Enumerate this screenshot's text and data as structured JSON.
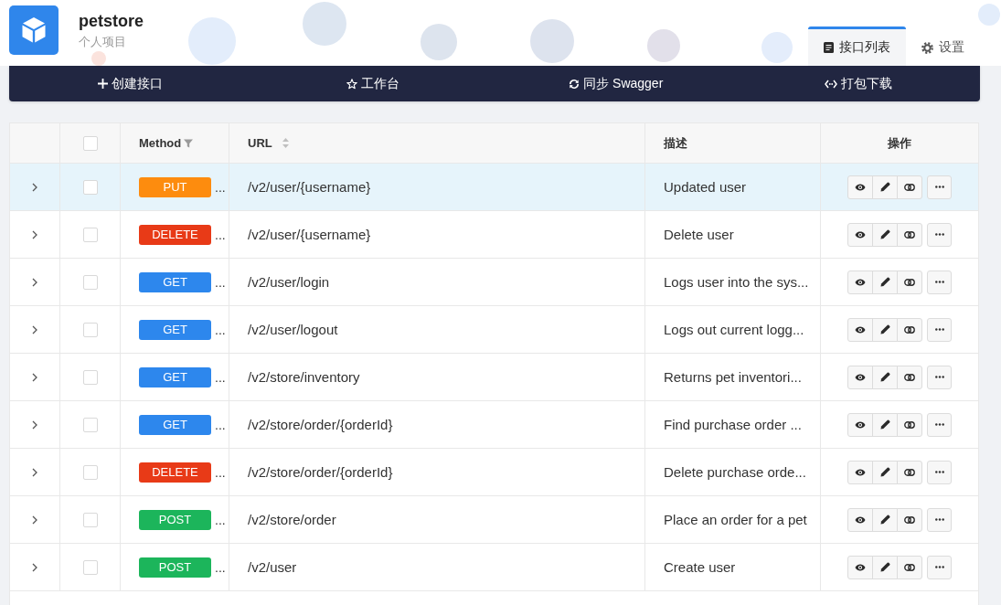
{
  "project": {
    "name": "petstore",
    "subtitle": "个人项目"
  },
  "tabs": [
    {
      "kind": "list",
      "label": "接口列表",
      "selected": true
    },
    {
      "kind": "settings",
      "label": "设置",
      "selected": false
    }
  ],
  "toolbar": [
    {
      "kind": "create",
      "label": "创建接口"
    },
    {
      "kind": "workbench",
      "label": "工作台"
    },
    {
      "kind": "sync",
      "label": "同步 Swagger"
    },
    {
      "kind": "download",
      "label": "打包下载"
    }
  ],
  "table": {
    "select_all_checked": false,
    "columns": [
      {
        "kind": "filter",
        "label": "Method"
      },
      {
        "kind": "sort",
        "label": "URL"
      },
      {
        "kind": "text",
        "label": "描述"
      },
      {
        "kind": "actions",
        "label": "操作"
      }
    ],
    "rows": [
      {
        "highlighted": true,
        "checked": false,
        "method": "PUT",
        "color": "#fd8c0e",
        "method_more": "...",
        "url": "/v2/user/{username}",
        "description": "Updated user"
      },
      {
        "highlighted": false,
        "checked": false,
        "method": "DELETE",
        "color": "#e83a17",
        "method_more": "...",
        "url": "/v2/user/{username}",
        "description": "Delete user"
      },
      {
        "highlighted": false,
        "checked": false,
        "method": "GET",
        "color": "#2d87ed",
        "method_more": "...",
        "url": "/v2/user/login",
        "description": "Logs user into the sys..."
      },
      {
        "highlighted": false,
        "checked": false,
        "method": "GET",
        "color": "#2d87ed",
        "method_more": "...",
        "url": "/v2/user/logout",
        "description": "Logs out current logg..."
      },
      {
        "highlighted": false,
        "checked": false,
        "method": "GET",
        "color": "#2d87ed",
        "method_more": "...",
        "url": "/v2/store/inventory",
        "description": "Returns pet inventori..."
      },
      {
        "highlighted": false,
        "checked": false,
        "method": "GET",
        "color": "#2d87ed",
        "method_more": "...",
        "url": "/v2/store/order/{orderId}",
        "description": "Find purchase order ..."
      },
      {
        "highlighted": false,
        "checked": false,
        "method": "DELETE",
        "color": "#e83a17",
        "method_more": "...",
        "url": "/v2/store/order/{orderId}",
        "description": "Delete purchase orde..."
      },
      {
        "highlighted": false,
        "checked": false,
        "method": "POST",
        "color": "#1cb55b",
        "method_more": "...",
        "url": "/v2/store/order",
        "description": "Place an order for a pet"
      },
      {
        "highlighted": false,
        "checked": false,
        "method": "POST",
        "color": "#1cb55b",
        "method_more": "...",
        "url": "/v2/user",
        "description": "Create user"
      }
    ]
  }
}
